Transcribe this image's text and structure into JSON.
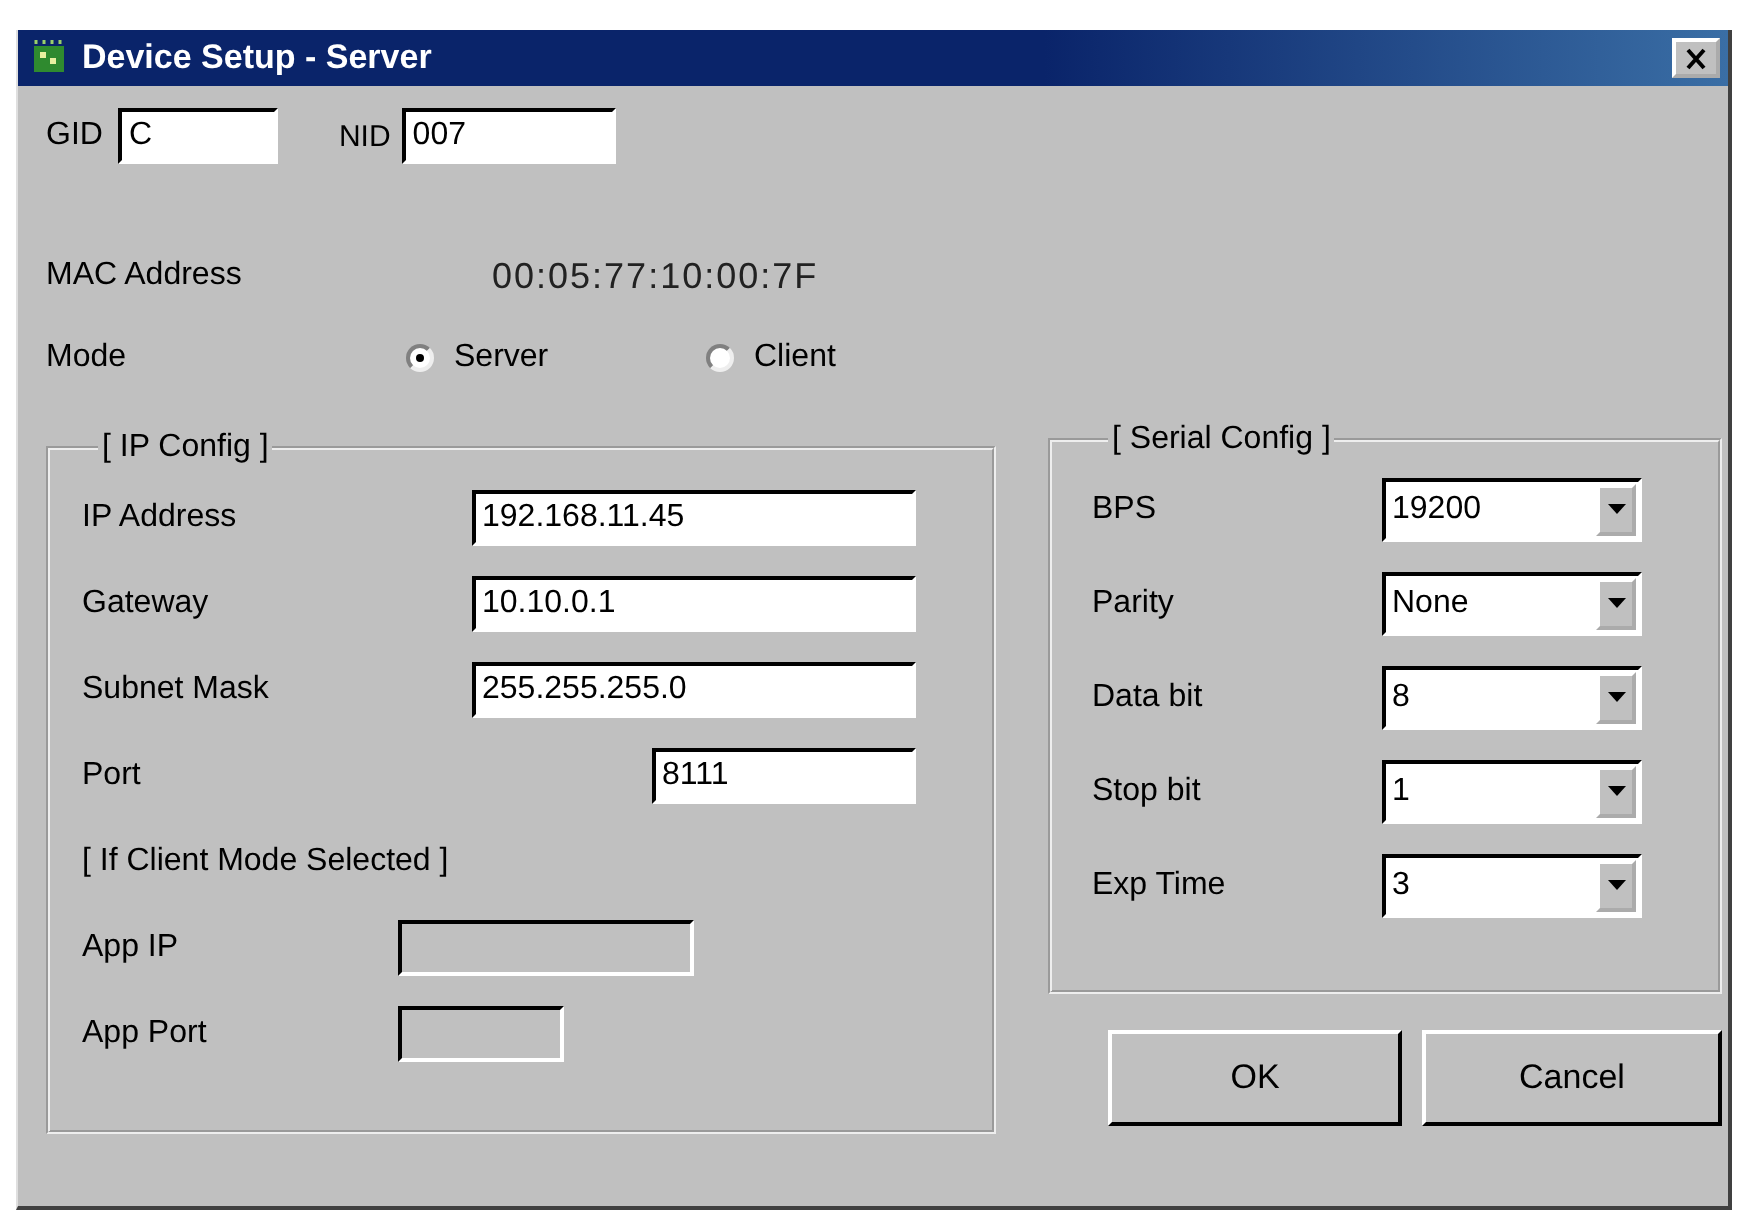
{
  "window": {
    "title": "Device Setup - Server"
  },
  "gid": {
    "label": "GID",
    "value": "C"
  },
  "nid": {
    "label": "NID",
    "value": "007"
  },
  "mac": {
    "label": "MAC Address",
    "value": "00:05:77:10:00:7F"
  },
  "mode": {
    "label": "Mode",
    "options": [
      {
        "label": "Server",
        "selected": true
      },
      {
        "label": "Client",
        "selected": false
      }
    ]
  },
  "ip_config": {
    "title": "[ IP Config ]",
    "fields": [
      {
        "label": "IP Address",
        "value": "192.168.11.45",
        "kind": "wide"
      },
      {
        "label": "Gateway",
        "value": "10.10.0.1",
        "kind": "wide"
      },
      {
        "label": "Subnet Mask",
        "value": "255.255.255.0",
        "kind": "wide"
      },
      {
        "label": "Port",
        "value": "8111",
        "kind": "right"
      }
    ],
    "client_note": "[ If Client Mode Selected ]",
    "client_fields": [
      {
        "label": "App IP",
        "kind": "wide",
        "disabled": true
      },
      {
        "label": "App Port",
        "kind": "short",
        "disabled": true
      }
    ]
  },
  "serial_config": {
    "title": "[ Serial Config ]",
    "fields": [
      {
        "label": "BPS",
        "value": "19200"
      },
      {
        "label": "Parity",
        "value": "None"
      },
      {
        "label": "Data bit",
        "value": "8"
      },
      {
        "label": "Stop bit",
        "value": "1"
      },
      {
        "label": "Exp Time",
        "value": "3"
      }
    ]
  },
  "buttons": [
    "OK",
    "Cancel"
  ]
}
